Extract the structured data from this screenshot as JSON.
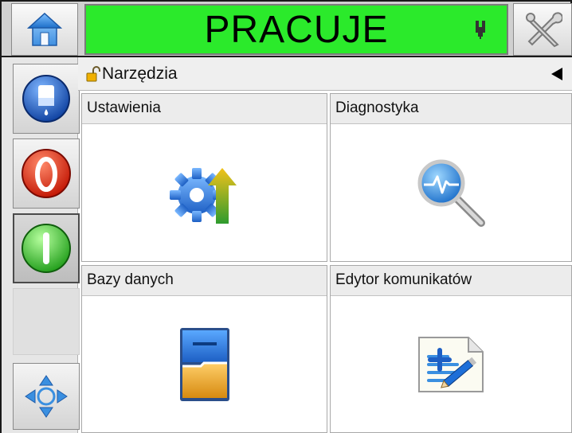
{
  "header": {
    "status": "PRACUJE",
    "status_color": "#2bea2b",
    "home_icon": "home-icon",
    "ink_icon": "ink-cartridge-icon",
    "tools_icon": "tools-icon"
  },
  "sidebar": {
    "items": [
      {
        "icon": "ink-bottle-icon"
      },
      {
        "icon": "stop-icon",
        "color": "#e22b1b"
      },
      {
        "icon": "start-icon",
        "color": "#3fcb35"
      },
      {
        "icon": "navigation-arrows-icon"
      }
    ]
  },
  "breadcrumb": {
    "title": "Narzędzia",
    "lock_icon": "unlocked-padlock-icon",
    "back_icon": "back-arrow-icon"
  },
  "tiles": [
    {
      "label": "Ustawienia",
      "icon": "settings-gear-icon"
    },
    {
      "label": "Diagnostyka",
      "icon": "diagnostics-magnifier-icon"
    },
    {
      "label": "Bazy danych",
      "icon": "database-cabinet-icon"
    },
    {
      "label": "Edytor komunikatów",
      "icon": "message-editor-icon"
    }
  ]
}
